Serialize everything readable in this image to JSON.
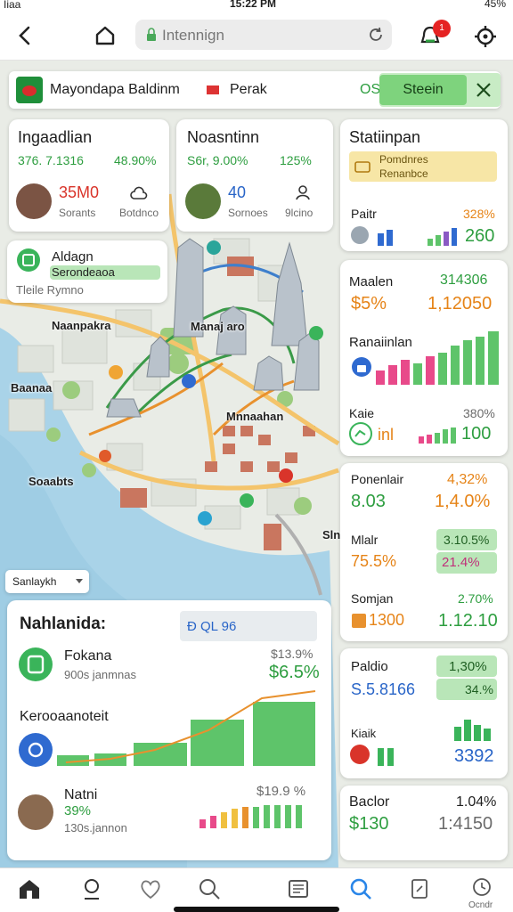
{
  "status_bar": {
    "carrier": "Iiaa",
    "time": "15:22 PM",
    "battery": "45%"
  },
  "browser": {
    "url": "Intennign",
    "notification_count": "1"
  },
  "banner": {
    "text": "Mayondapa Baldinm",
    "flag_label": "Perak",
    "code": "OS",
    "button_label": "Steein"
  },
  "card1": {
    "title": "Ingaadlian",
    "stat_a": "376. 7.1316",
    "stat_b": "48.90%",
    "value": "35M0",
    "sub_a": "Sorants",
    "sub_b": "Botdnco"
  },
  "card2": {
    "title": "Noasntinn",
    "stat_a": "S6r, 9.00%",
    "stat_b": "125%",
    "value": "40",
    "sub_a": "Sornoes",
    "sub_b": "9lcino"
  },
  "card3": {
    "title": "Aldagn",
    "highlight": "Serondeaoa",
    "sub": "Tleile Rymno"
  },
  "map_labels": {
    "a": "Naanpakra",
    "b": "Manaj aro",
    "c": "Mnnaahan",
    "d": "Baanaa",
    "e": "Soaabts",
    "f": "Sln",
    "dropdown": "Sanlaykh"
  },
  "panel_list": {
    "title": "Nahlanida:",
    "badge": "Ð QL 96",
    "row1_title": "Fokana",
    "row1_sub": "900s janmnas",
    "row1_top": "$13.9%",
    "row1_val": "$6.5%",
    "row2_title": "Kerooaanoteit",
    "row3_title": "Natni",
    "row3_pct": "39%",
    "row3_sub": "130s.jannon",
    "row3_val": "$19.9 %"
  },
  "side": {
    "stat_title": "Statiinpan",
    "stat_highlight_1": "Pomdnres",
    "stat_highlight_2": "Renanbce",
    "pair_label": "Paitr",
    "pair_pct": "328%",
    "pair_val": "260",
    "med_label": "Maalen",
    "med_a": "314306",
    "med_b": "$5%",
    "med_c": "1,12050",
    "ran_label": "Ranaiinlan",
    "kar_label": "Kaie",
    "kar_pct": "380%",
    "kar_a": "inl",
    "kar_b": "100",
    "pot_label": "Ponenlair",
    "pot_pct": "4,32%",
    "pot_a": "8.03",
    "pot_b": "1,4.0%",
    "maw_label": "Mlalr",
    "maw_a": "3.10.5%",
    "maw_b": "75.5%",
    "maw_c": "21.4%",
    "som_label": "Somjan",
    "som_pct": "2.70%",
    "som_a": "1300",
    "som_b": "1.12.10",
    "pal_label": "Paldio",
    "pal_a": "1,30%",
    "pal_b": "34.%",
    "pal_c": "S.5.8166",
    "kor_label": "Kiaik",
    "kor_val": "3392",
    "bac_label": "Baclor",
    "bac_pct": "1.04%",
    "bac_a": "$130",
    "bac_b": "1:4150"
  },
  "nav": {
    "last_label": "Ocndr"
  },
  "colors": {
    "accent_green": "#2e9e40",
    "accent_red": "#d9342a",
    "accent_orange": "#e68418",
    "accent_blue": "#2965c8",
    "water": "#a9d3e8"
  }
}
